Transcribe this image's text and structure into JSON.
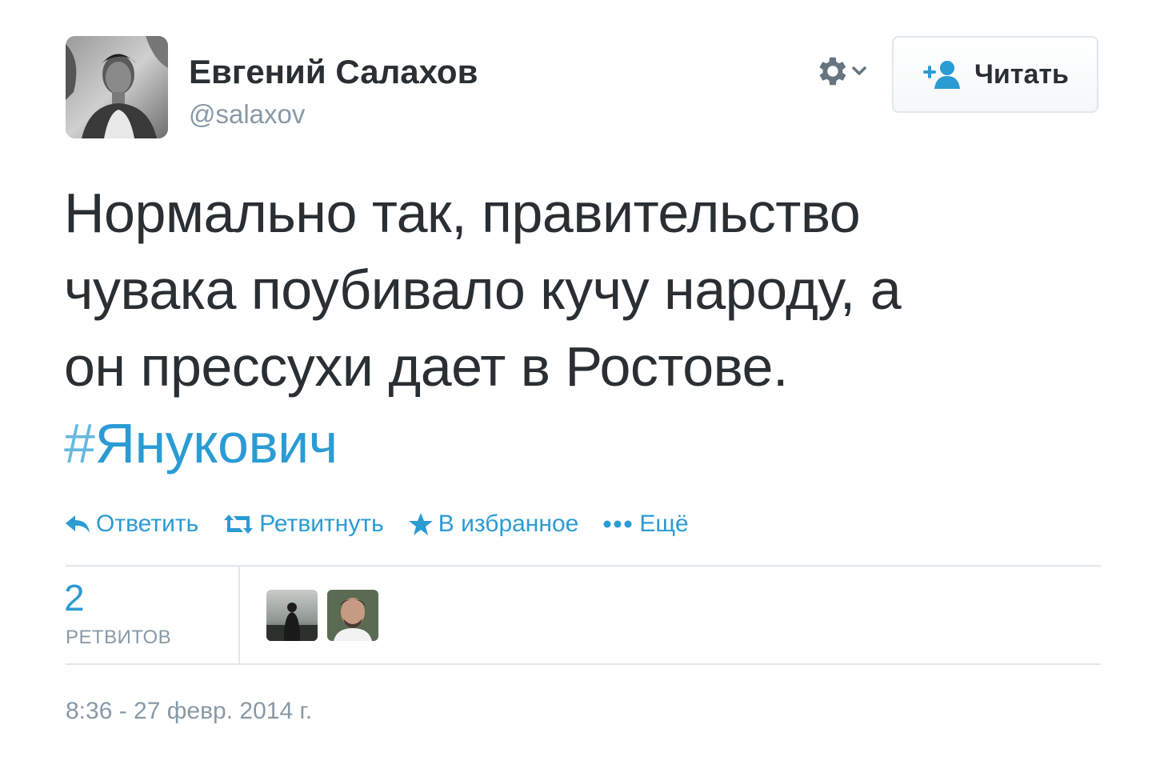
{
  "author": {
    "name": "Евгений Салахов",
    "handle": "@salaxov"
  },
  "header": {
    "settings_icon": "gear-icon",
    "follow_label": "Читать",
    "follow_icon": "add-user-icon"
  },
  "tweet": {
    "lines": [
      "Нормально так, правительство",
      "чувака поубивало кучу народу, а",
      "он прессухи дает в Ростове."
    ],
    "hashtag_symbol": "#",
    "hashtag": "Янукович"
  },
  "actions": {
    "reply": "Ответить",
    "retweet": "Ретвитнуть",
    "favorite": "В избранное",
    "more": "Ещё"
  },
  "stats": {
    "retweets": "2",
    "retweets_label": "РЕТВИТОВ"
  },
  "timestamp": "8:36 - 27 февр. 2014 г.",
  "colors": {
    "link": "#2b9bd4",
    "muted": "#8899a6",
    "text": "#292f33",
    "border": "#e1e8ed"
  }
}
